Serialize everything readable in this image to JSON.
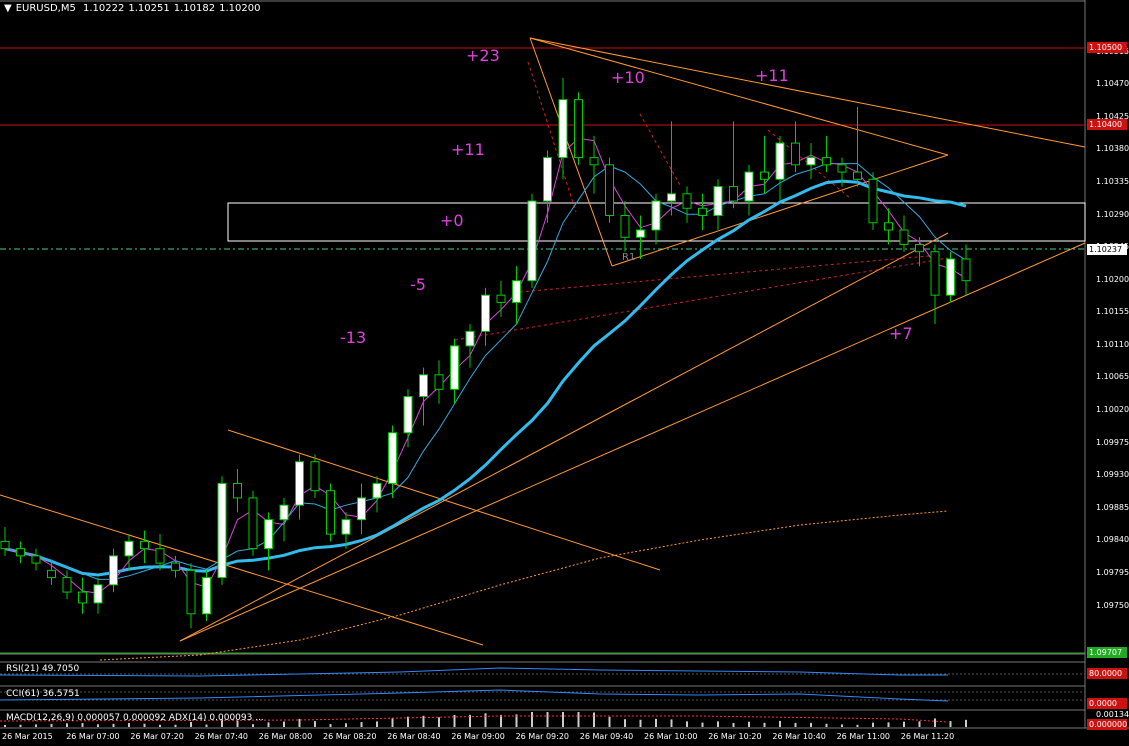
{
  "header": {
    "symbol": "EURUSD,M5",
    "ohlc": [
      "1.10222",
      "1.10251",
      "1.10182",
      "1.10200"
    ]
  },
  "colors": {
    "background": "#000000",
    "bull_candle": "#ffffff",
    "bear_candle": "#000000",
    "wick": "#00cc00",
    "ma_fast": "#dd44dd",
    "ma_mid": "#33aadd",
    "ma_slow": "#33bbee",
    "trendline": "#ff9933",
    "resistance": "#cc1111",
    "pip_labels": "#e040e0"
  },
  "price_axis": {
    "ticks": [
      "1.10515",
      "1.10470",
      "1.10425",
      "1.10380",
      "1.10335",
      "1.10290",
      "1.10245",
      "1.10200",
      "1.10155",
      "1.10110",
      "1.10065",
      "1.10020",
      "1.09975",
      "1.09930",
      "1.09885",
      "1.09840",
      "1.09795",
      "1.09750"
    ],
    "tags": [
      {
        "value": "1.10500",
        "kind": "resistance"
      },
      {
        "value": "1.10400",
        "kind": "resistance"
      },
      {
        "value": "1.10237",
        "kind": "current"
      },
      {
        "value": "1.09707",
        "kind": "support"
      }
    ]
  },
  "time_axis": [
    "26 Mar 2015",
    "26 Mar 07:00",
    "26 Mar 07:20",
    "26 Mar 07:40",
    "26 Mar 08:00",
    "26 Mar 08:20",
    "26 Mar 08:40",
    "26 Mar 09:00",
    "26 Mar 09:20",
    "26 Mar 09:40",
    "26 Mar 10:00",
    "26 Mar 10:20",
    "26 Mar 10:40",
    "26 Mar 11:00",
    "26 Mar 11:20"
  ],
  "pip_annotations": [
    "+23",
    "+10",
    "+11",
    "+11",
    "+0",
    "-5",
    "-13",
    "+7"
  ],
  "zone_label": "R1",
  "indicators": {
    "rsi": {
      "label": "RSI(21) 49.7050",
      "value": "80.0000"
    },
    "cci": {
      "label": "CCI(61) 36.5751",
      "value": "0.0000"
    },
    "macd": {
      "label": "MACD(12,26,9) 0.000057 0.000092 ADX(14) 0.000093 ...",
      "value": "0.001348",
      "value2": "0.000000"
    }
  },
  "chart_data": {
    "type": "candlestick",
    "title": "EURUSD,M5",
    "ylim": [
      1.0969,
      1.1056
    ],
    "x_start": "26 Mar 2015 06:55",
    "candles": [
      [
        1.0984,
        1.0986,
        1.0982,
        1.0983
      ],
      [
        1.0983,
        1.0984,
        1.0981,
        1.0982
      ],
      [
        1.0982,
        1.0983,
        1.098,
        1.0981
      ],
      [
        1.098,
        1.09815,
        1.0978,
        1.0979
      ],
      [
        1.0979,
        1.098,
        1.0976,
        1.0977
      ],
      [
        1.0977,
        1.0979,
        1.0974,
        1.09755
      ],
      [
        1.09755,
        1.0979,
        1.0974,
        1.0978
      ],
      [
        1.0978,
        1.0983,
        1.0977,
        1.0982
      ],
      [
        1.0982,
        1.0985,
        1.098,
        1.0984
      ],
      [
        1.0984,
        1.09855,
        1.0981,
        1.0983
      ],
      [
        1.0983,
        1.0985,
        1.098,
        1.0981
      ],
      [
        1.0981,
        1.0982,
        1.0979,
        1.098
      ],
      [
        1.098,
        1.0981,
        1.0972,
        1.0974
      ],
      [
        1.0974,
        1.098,
        1.0973,
        1.0979
      ],
      [
        1.0979,
        1.0993,
        1.0978,
        1.0992
      ],
      [
        1.0992,
        1.0994,
        1.0988,
        1.099
      ],
      [
        1.099,
        1.0991,
        1.0982,
        1.0983
      ],
      [
        1.0983,
        1.0988,
        1.098,
        1.0987
      ],
      [
        1.0987,
        1.099,
        1.0984,
        1.0989
      ],
      [
        1.0989,
        1.0996,
        1.0987,
        1.0995
      ],
      [
        1.0995,
        1.0996,
        1.099,
        1.0991
      ],
      [
        1.0991,
        1.0992,
        1.0984,
        1.0985
      ],
      [
        1.0985,
        1.0988,
        1.0983,
        1.0987
      ],
      [
        1.0987,
        1.0992,
        1.0985,
        1.099
      ],
      [
        1.099,
        1.0993,
        1.0988,
        1.0992
      ],
      [
        1.0992,
        1.1,
        1.099,
        1.0999
      ],
      [
        1.0999,
        1.1005,
        1.0997,
        1.1004
      ],
      [
        1.1004,
        1.1008,
        1.1,
        1.1007
      ],
      [
        1.1007,
        1.1009,
        1.1003,
        1.1005
      ],
      [
        1.1005,
        1.1012,
        1.1003,
        1.1011
      ],
      [
        1.1011,
        1.1014,
        1.1008,
        1.1013
      ],
      [
        1.1013,
        1.1019,
        1.1011,
        1.1018
      ],
      [
        1.1018,
        1.102,
        1.1015,
        1.1017
      ],
      [
        1.1017,
        1.1022,
        1.1014,
        1.102
      ],
      [
        1.102,
        1.1032,
        1.1019,
        1.1031
      ],
      [
        1.1031,
        1.1038,
        1.1028,
        1.1037
      ],
      [
        1.1037,
        1.1048,
        1.1034,
        1.1045
      ],
      [
        1.1045,
        1.1046,
        1.1036,
        1.1037
      ],
      [
        1.1037,
        1.104,
        1.1032,
        1.1036
      ],
      [
        1.1036,
        1.1037,
        1.1028,
        1.1029
      ],
      [
        1.1029,
        1.1031,
        1.1024,
        1.1026
      ],
      [
        1.1026,
        1.1029,
        1.1023,
        1.1027
      ],
      [
        1.1027,
        1.1032,
        1.1025,
        1.1031
      ],
      [
        1.1031,
        1.1042,
        1.1029,
        1.1032
      ],
      [
        1.1032,
        1.1033,
        1.1028,
        1.103
      ],
      [
        1.103,
        1.1032,
        1.1027,
        1.1029
      ],
      [
        1.1029,
        1.1034,
        1.1027,
        1.1033
      ],
      [
        1.1033,
        1.1042,
        1.103,
        1.1031
      ],
      [
        1.1031,
        1.1036,
        1.1029,
        1.1035
      ],
      [
        1.1035,
        1.104,
        1.1032,
        1.1034
      ],
      [
        1.1034,
        1.104,
        1.1031,
        1.1039
      ],
      [
        1.1039,
        1.1042,
        1.1035,
        1.1036
      ],
      [
        1.1036,
        1.1039,
        1.1034,
        1.1037
      ],
      [
        1.1037,
        1.104,
        1.1035,
        1.1036
      ],
      [
        1.1036,
        1.1037,
        1.1033,
        1.1035
      ],
      [
        1.1035,
        1.1044,
        1.1033,
        1.1034
      ],
      [
        1.1034,
        1.1035,
        1.1027,
        1.1028
      ],
      [
        1.1028,
        1.103,
        1.1025,
        1.1027
      ],
      [
        1.1027,
        1.1029,
        1.1024,
        1.1025
      ],
      [
        1.1025,
        1.1026,
        1.1022,
        1.1024
      ],
      [
        1.1024,
        1.1025,
        1.1014,
        1.1018
      ],
      [
        1.1018,
        1.1024,
        1.1017,
        1.1023
      ],
      [
        1.1023,
        1.1025,
        1.1018,
        1.102
      ]
    ]
  }
}
